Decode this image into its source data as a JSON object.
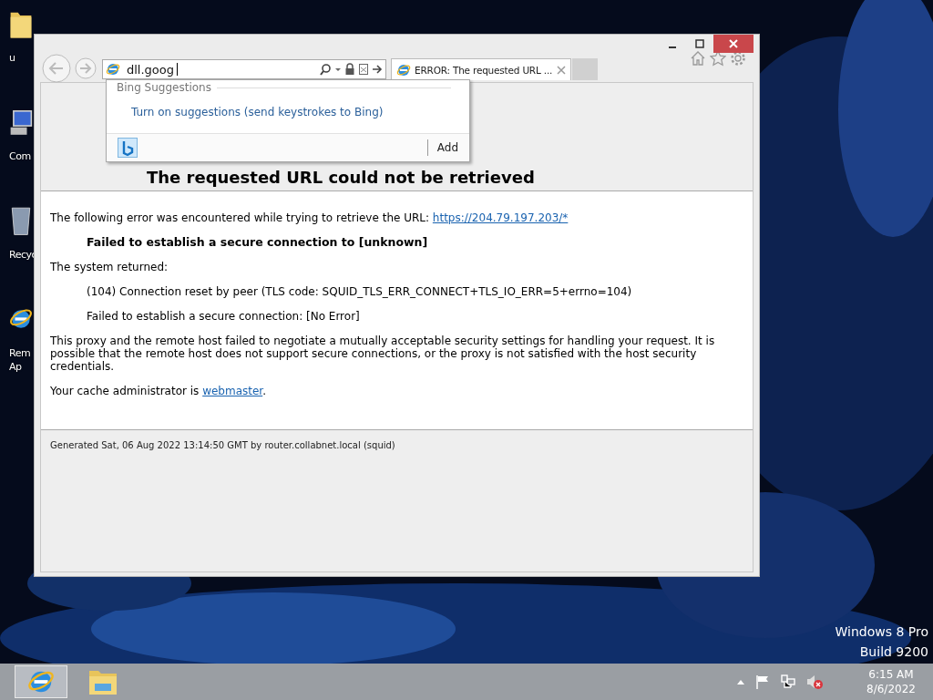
{
  "desktop": {
    "icons": [
      {
        "kind": "folder",
        "lines": [
          "u"
        ]
      },
      {
        "kind": "computer",
        "lines": [
          "Com"
        ]
      },
      {
        "kind": "recycle",
        "lines": [
          "Recyc"
        ]
      },
      {
        "kind": "ie",
        "lines": [
          "Rem",
          "Ap"
        ]
      }
    ],
    "watermark": [
      "Windows 8 Pro",
      "Build 9200"
    ]
  },
  "browser": {
    "address": {
      "value": "dll.goog"
    },
    "tabs": [
      {
        "title": "ERROR: The requested URL ...",
        "selected": true
      }
    ],
    "suggestions": {
      "header": "Bing Suggestions",
      "link": "Turn on suggestions (send keystrokes to Bing)",
      "add": "Add"
    },
    "page": {
      "heading": "The requested URL could not be retrieved",
      "intro": "The following error was encountered while trying to retrieve the URL:",
      "url": "https://204.79.197.203/*",
      "error": "Failed to establish a secure connection to [unknown]",
      "returned": "The system returned:",
      "details": [
        "(104) Connection reset by peer (TLS code: SQUID_TLS_ERR_CONNECT+TLS_IO_ERR=5+errno=104)",
        "Failed to establish a secure connection: [No Error]"
      ],
      "explanation": "This proxy and the remote host failed to negotiate a mutually acceptable security settings for handling your request. It is possible that the remote host does not support secure connections, or the proxy is not satisfied with the host security credentials.",
      "admin": "Your cache administrator is",
      "admin_link": "webmaster",
      "admin_end": ".",
      "footer": "Generated Sat, 06 Aug 2022 13:14:50 GMT by router.collabnet.local (squid)"
    }
  },
  "taskbar": {
    "apps": [
      {
        "kind": "ie",
        "selected": true
      },
      {
        "kind": "explorer",
        "selected": false
      }
    ],
    "clock": {
      "time": "6:15 AM",
      "date": "8/6/2022"
    }
  }
}
